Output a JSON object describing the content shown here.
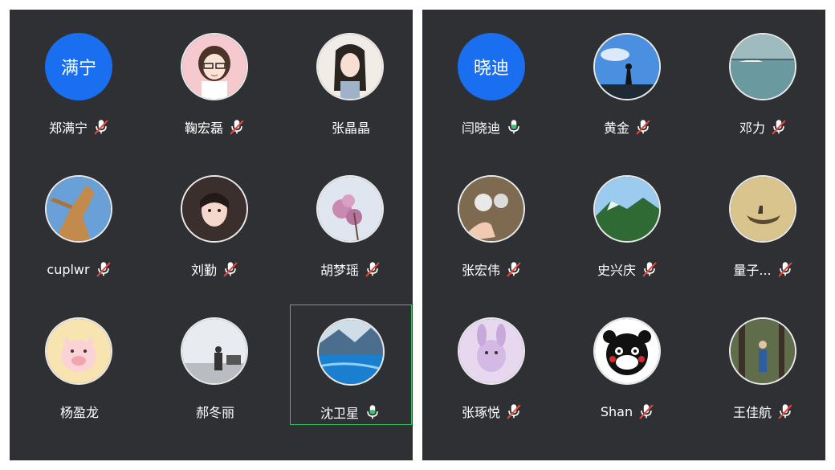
{
  "panels": [
    {
      "id": "left",
      "participants": [
        {
          "name": "郑满宁",
          "avatar": {
            "kind": "initials",
            "text": "满宁",
            "color": "#1a6ff0"
          },
          "mic": "muted"
        },
        {
          "name": "鞠宏磊",
          "avatar": {
            "kind": "image",
            "icon": "cartoon-girl-glasses-image"
          },
          "mic": "muted"
        },
        {
          "name": "张晶晶",
          "avatar": {
            "kind": "image",
            "icon": "anime-girl-image"
          },
          "mic": "none"
        },
        {
          "name": "cuplwr",
          "avatar": {
            "kind": "image",
            "icon": "tree-branch-image"
          },
          "mic": "muted"
        },
        {
          "name": "刘勤",
          "avatar": {
            "kind": "image",
            "icon": "girl-portrait-image"
          },
          "mic": "muted"
        },
        {
          "name": "胡梦瑶",
          "avatar": {
            "kind": "image",
            "icon": "flower-blossom-image"
          },
          "mic": "muted"
        },
        {
          "name": "杨盈龙",
          "avatar": {
            "kind": "image",
            "icon": "cartoon-pig-image"
          },
          "mic": "none"
        },
        {
          "name": "郝冬丽",
          "avatar": {
            "kind": "image",
            "icon": "street-photo-image"
          },
          "mic": "none"
        },
        {
          "name": "沈卫星",
          "avatar": {
            "kind": "image",
            "icon": "mountain-lake-image"
          },
          "mic": "active",
          "speaking": true
        }
      ]
    },
    {
      "id": "right",
      "participants": [
        {
          "name": "闫晓迪",
          "avatar": {
            "kind": "initials",
            "text": "晓迪",
            "color": "#1a6ff0"
          },
          "mic": "active"
        },
        {
          "name": "黄金",
          "avatar": {
            "kind": "image",
            "icon": "sky-silhouette-image"
          },
          "mic": "muted"
        },
        {
          "name": "邓力",
          "avatar": {
            "kind": "image",
            "icon": "ocean-landscape-image"
          },
          "mic": "muted"
        },
        {
          "name": "张宏伟",
          "avatar": {
            "kind": "image",
            "icon": "dandelion-hand-image"
          },
          "mic": "muted"
        },
        {
          "name": "史兴庆",
          "avatar": {
            "kind": "image",
            "icon": "green-mountain-image"
          },
          "mic": "muted"
        },
        {
          "name": "量子...",
          "avatar": {
            "kind": "image",
            "icon": "boat-painting-image"
          },
          "mic": "muted"
        },
        {
          "name": "张琢悦",
          "avatar": {
            "kind": "image",
            "icon": "plush-bunny-image"
          },
          "mic": "muted"
        },
        {
          "name": "Shan",
          "avatar": {
            "kind": "image",
            "icon": "kumamon-bear-image"
          },
          "mic": "muted"
        },
        {
          "name": "王佳航",
          "avatar": {
            "kind": "image",
            "icon": "forest-person-image"
          },
          "mic": "muted"
        }
      ]
    }
  ],
  "colors": {
    "panel_bg": "#2f3033",
    "accent": "#1a6ff0",
    "speaking_border": "#34c463",
    "muted_red": "#e5483d"
  }
}
